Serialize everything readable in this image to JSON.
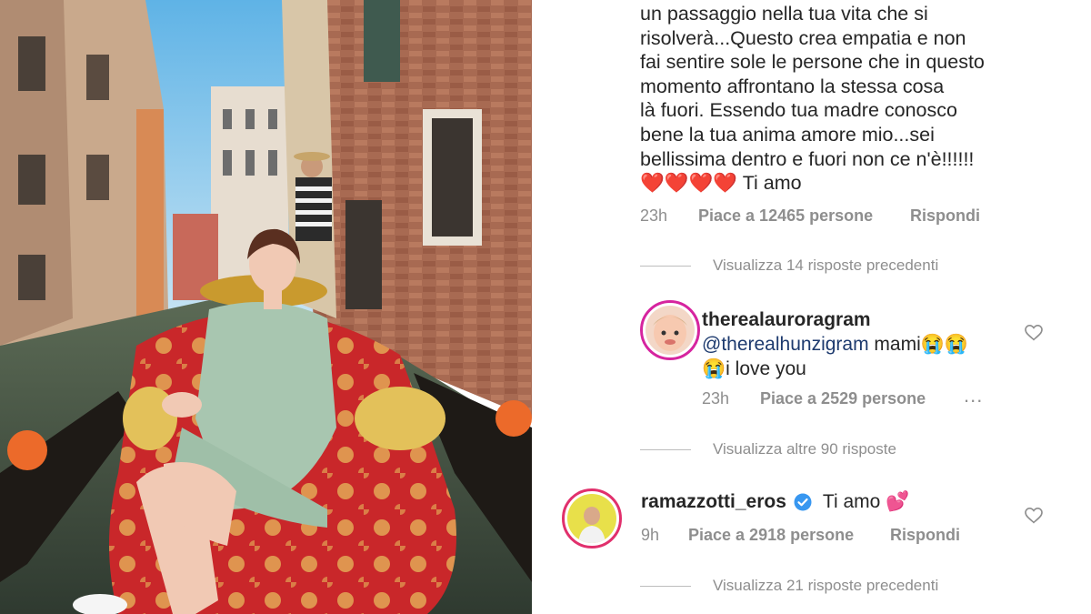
{
  "post": {
    "caption_lines": [
      "un passaggio nella tua vita che si",
      "risolverà...Questo crea empatia e non",
      "fai sentire sole le persone che in questo",
      "momento affrontano la stessa cosa",
      "là fuori.  Essendo tua madre conosco",
      "bene la tua anima amore mio...sei",
      "bellissima dentro e fuori non ce n'è!!!!!!"
    ],
    "caption_hearts": "❤️❤️❤️❤️",
    "caption_end": "Ti amo",
    "caption_time": "23h",
    "caption_likes": "Piace a 12465 persone",
    "caption_reply": "Rispondi"
  },
  "thread1": {
    "view_previous": "Visualizza 14 risposte precedenti",
    "reply": {
      "username": "therealauroragram",
      "mention": "@therealhunzigram",
      "text": "mami😭😭",
      "text2": "😭i love you",
      "time": "23h",
      "likes": "Piace a 2529 persone",
      "more": "..."
    },
    "view_more": "Visualizza altre 90 risposte"
  },
  "comment2": {
    "username": "ramazzotti_eros",
    "verified_icon": "verified-badge",
    "text": "Ti amo 💕",
    "time": "9h",
    "likes": "Piace a 2918 persone",
    "reply": "Rispondi",
    "view_previous": "Visualizza 21 risposte precedenti"
  },
  "colors": {
    "text": "#262626",
    "muted": "#8e8e8e",
    "mention": "#1d3a6e",
    "verified": "#3897f0",
    "story_ring": "#c13584"
  }
}
